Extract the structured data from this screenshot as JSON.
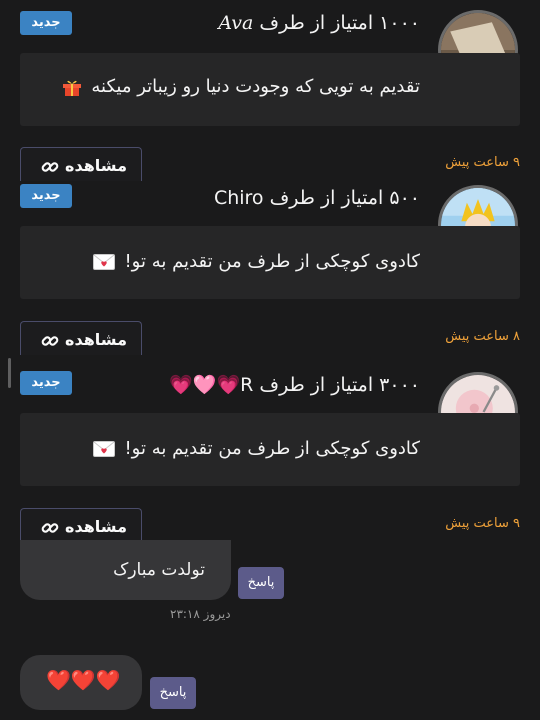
{
  "notifications": [
    {
      "title_prefix": "۱۰۰۰ امتیاز از طرف",
      "sender": "Ava",
      "badge": "جدید",
      "message": "تقدیم به تویی که وجودت دنیا رو زیباتر میکنه",
      "message_icon": "gift-icon",
      "view_label": "مشاهده",
      "time": "۹ ساعت پیش"
    },
    {
      "title_prefix": "۵۰۰ امتیاز از طرف",
      "sender": "Chiro",
      "badge": "جدید",
      "message": "کادوی کوچکی از طرف من تقدیم به تو!",
      "message_icon": "love-letter-icon",
      "view_label": "مشاهده",
      "time": "۸ ساعت پیش"
    },
    {
      "title_prefix": "۳۰۰۰ امتیاز از طرف",
      "sender": "R",
      "sender_decoration": "💗🩷💗",
      "badge": "جدید",
      "message": "کادوی کوچکی از طرف من تقدیم به تو!",
      "message_icon": "love-letter-icon",
      "view_label": "مشاهده",
      "time": "۹ ساعت پیش"
    }
  ],
  "messages": [
    {
      "text": "تولدت مبارک",
      "reply_label": "پاسخ",
      "timestamp": "دیروز ۲۳:۱۸"
    },
    {
      "text": "❤️❤️❤️",
      "reply_label": "پاسخ"
    }
  ],
  "colors": {
    "background": "#1a1a1b",
    "card": "#262627",
    "badge": "#3b83c3",
    "time": "#f0a23a",
    "reply_button": "#5c5b8a",
    "bubble": "#363638"
  }
}
